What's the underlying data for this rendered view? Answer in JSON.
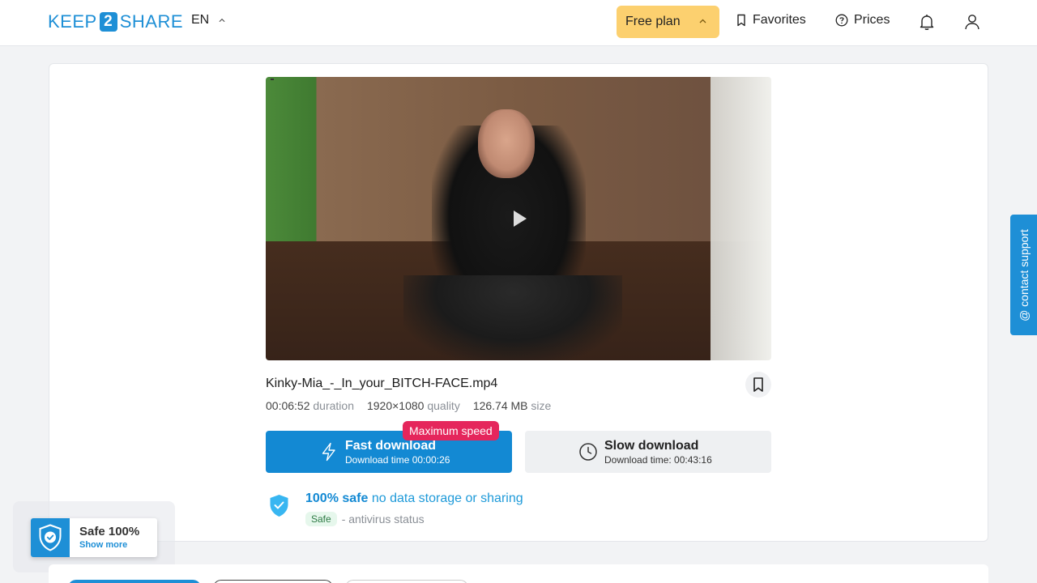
{
  "header": {
    "logo": {
      "part1": "KEEP",
      "part2": "2",
      "part3": "SHARE"
    },
    "language": "EN",
    "plan_label": "Free plan",
    "favorites_label": "Favorites",
    "prices_label": "Prices"
  },
  "file": {
    "name": "Kinky-Mia_-_In_your_BITCH-FACE.mp4",
    "duration_value": "00:06:52",
    "duration_label": "duration",
    "quality_value": "1920×1080",
    "quality_label": "quality",
    "size_value": "126.74 MB",
    "size_label": "size"
  },
  "downloads": {
    "fast_title": "Fast download",
    "fast_time": "Download time 00:00:26",
    "fast_badge": "Maximum speed",
    "slow_title": "Slow download",
    "slow_time": "Download time: 00:43:16"
  },
  "security": {
    "safe_bold": "100% safe",
    "safe_note": "no data storage or sharing",
    "status_tag": "Safe",
    "status_desc": "- antivirus status"
  },
  "contact_support": "@ contact support",
  "safe_widget": {
    "title": "Safe 100%",
    "link": "Show more"
  },
  "colors": {
    "brand": "#1e8fd6",
    "fast_button": "#1389d3",
    "badge": "#e5265c",
    "plan_button": "#fcd06f"
  }
}
